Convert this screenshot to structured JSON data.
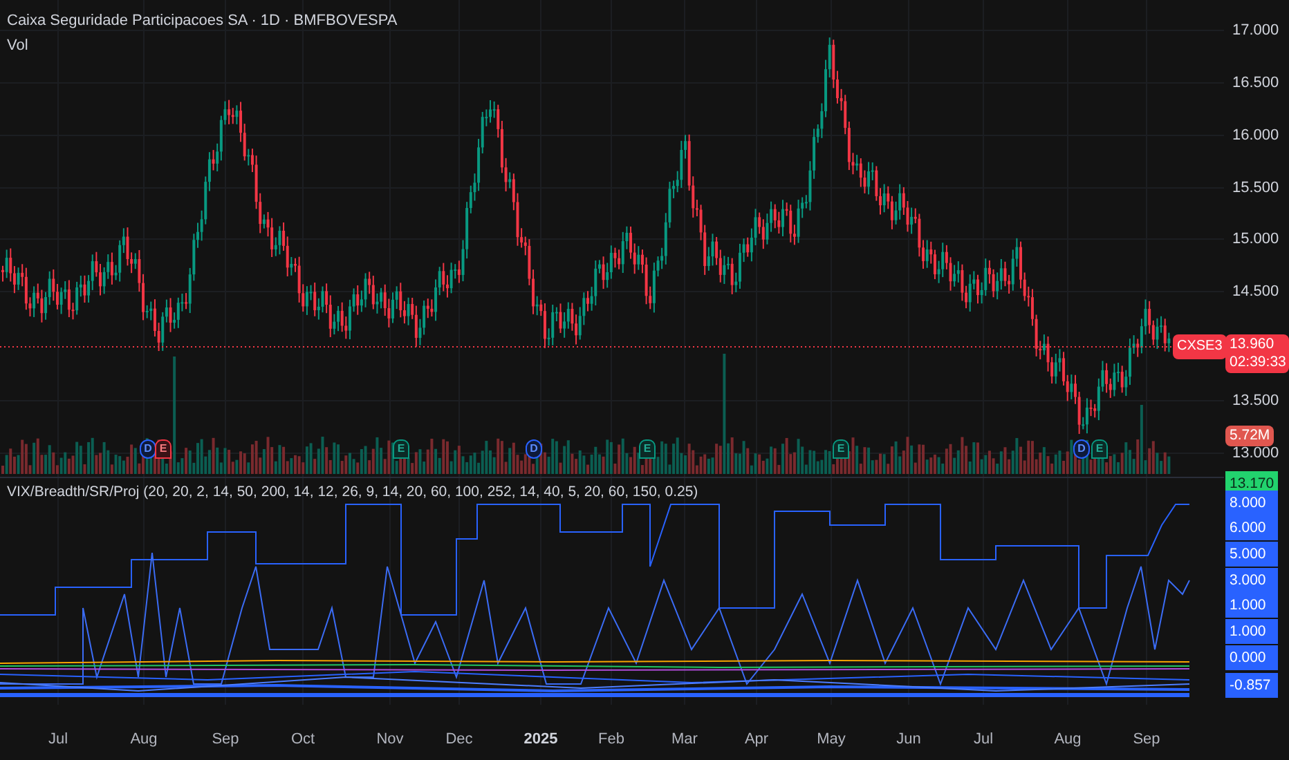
{
  "chart": {
    "title": "Caixa Seguridade Participacoes SA · 1D · BMFBOVESPA",
    "volume_label": "Vol",
    "price_axis": [
      "17.000",
      "16.500",
      "16.000",
      "15.500",
      "15.000",
      "14.500",
      "13.500",
      "13.000"
    ],
    "symbol_tag": "CXSE3",
    "last_price": "13.960",
    "countdown": "02:39:33",
    "volume_tag": "5.72M",
    "events": [
      {
        "label": "D",
        "kind": "dividend"
      },
      {
        "label": "E",
        "kind": "earnings-miss"
      },
      {
        "label": "E",
        "kind": "earnings"
      },
      {
        "label": "D",
        "kind": "dividend"
      },
      {
        "label": "E",
        "kind": "earnings"
      },
      {
        "label": "E",
        "kind": "earnings"
      },
      {
        "label": "D",
        "kind": "dividend"
      },
      {
        "label": "E",
        "kind": "earnings"
      }
    ]
  },
  "indicator": {
    "label": "VIX/Breadth/SR/Proj (20, 20, 2, 14, 50, 200, 14, 12, 26, 9, 14, 20, 60, 100, 252, 14, 40, 5, 20, 60, 150, 0.25)",
    "tags": [
      {
        "text": "13.170",
        "color": "#22d36e"
      },
      {
        "text": "8.000",
        "color": "#2962ff"
      },
      {
        "text": "6.000",
        "color": "#2962ff"
      },
      {
        "text": "5.000",
        "color": "#2962ff"
      },
      {
        "text": "3.000",
        "color": "#2962ff"
      },
      {
        "text": "1.000",
        "color": "#2962ff"
      },
      {
        "text": "1.000",
        "color": "#2962ff"
      },
      {
        "text": "0.000",
        "color": "#2962ff"
      },
      {
        "text": "-0.857",
        "color": "#2962ff"
      }
    ]
  },
  "time_axis": [
    {
      "label": "Jul",
      "kind": "month"
    },
    {
      "label": "Aug",
      "kind": "month"
    },
    {
      "label": "Sep",
      "kind": "month"
    },
    {
      "label": "Oct",
      "kind": "month"
    },
    {
      "label": "Nov",
      "kind": "month"
    },
    {
      "label": "Dec",
      "kind": "month"
    },
    {
      "label": "2025",
      "kind": "year"
    },
    {
      "label": "Feb",
      "kind": "month"
    },
    {
      "label": "Mar",
      "kind": "month"
    },
    {
      "label": "Apr",
      "kind": "month"
    },
    {
      "label": "May",
      "kind": "month"
    },
    {
      "label": "Jun",
      "kind": "month"
    },
    {
      "label": "Jul",
      "kind": "month"
    },
    {
      "label": "Aug",
      "kind": "month"
    },
    {
      "label": "Sep",
      "kind": "month"
    }
  ]
}
